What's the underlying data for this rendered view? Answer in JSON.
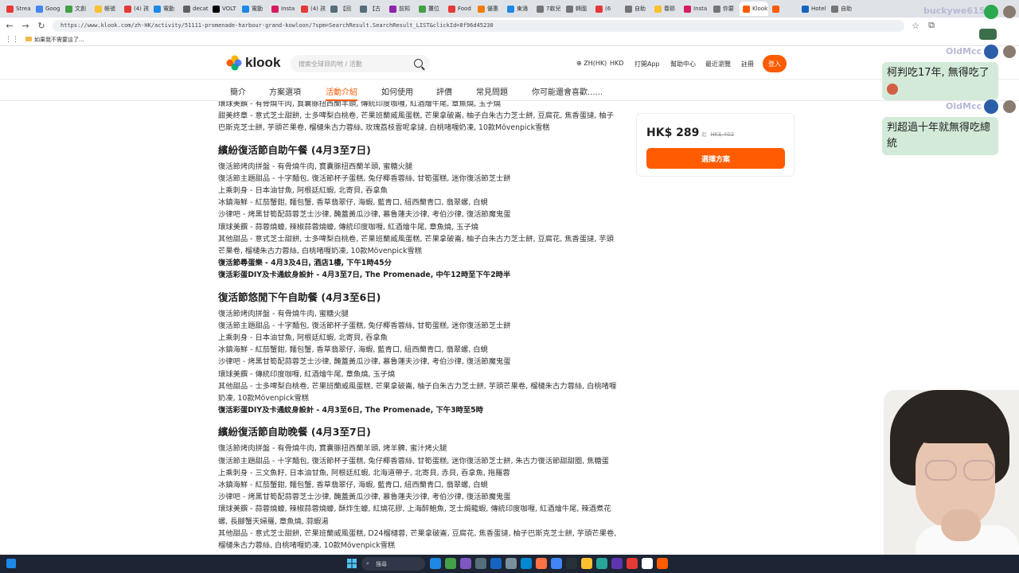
{
  "browser": {
    "tabs": [
      "Strea",
      "Goog",
      "文創",
      "帳號",
      "(4) 孩",
      "電動",
      "decat",
      "VOLT",
      "電動",
      "Insta",
      "(4) 孩",
      "【回",
      "【古",
      "前知",
      "攤位",
      "Food",
      "優惠",
      "東涌",
      "7款兒",
      "韓國",
      "(6",
      "自助",
      "春節",
      "Insta",
      "你要",
      "Klook",
      "",
      "Hotel",
      "自助"
    ],
    "tab_colors": [
      "#e53935",
      "#4285f4",
      "#43a047",
      "#fbc02d",
      "#e53935",
      "#1e88e5",
      "#616161",
      "#000000",
      "#1e88e5",
      "#d81b60",
      "#e53935",
      "#546e7a",
      "#546e7a",
      "#8e24aa",
      "#43a047",
      "#e53935",
      "#f57c00",
      "#1e88e5",
      "#757575",
      "#757575",
      "#e53935",
      "#757575",
      "#fbc02d",
      "#d81b60",
      "#757575",
      "#ff5b00",
      "#ff5b00",
      "#1565c0",
      "#757575"
    ],
    "url": "https://www.klook.com/zh-HK/activity/51111-promenade-harbour-grand-kowloon/?spm=SearchResult.SearchResult_LIST&clickId=8f96d45230",
    "bookmark": "如果我不需要這了..."
  },
  "header": {
    "logo_text": "klook",
    "search_placeholder": "搜索全球目的地 / 活動",
    "lang": "ZH(HK)",
    "currency": "HKD",
    "app": "打開App",
    "help": "幫助中心",
    "recent": "最近瀏覽",
    "register": "註冊",
    "login": "登入"
  },
  "subnav": [
    "簡介",
    "方案選項",
    "活動介紹",
    "如何使用",
    "評價",
    "常見問題",
    "你可能還會喜歡......"
  ],
  "price_card": {
    "price": "HK$ 289",
    "unit": "起",
    "old_price": "HK$ 402",
    "button": "選擇方案"
  },
  "content": [
    {
      "type": "line",
      "text": "環球美饌 - 有骨燒牛肉, 寶囊豚扭西蘭羊頭, 傳統印度咖喱, 紅酒燴牛尾, 章魚燒, 玉子燒"
    },
    {
      "type": "wrap",
      "text": "甜美終章 - 意式芝士甜餅, 士多啤梨白桃卷, 芒果班蘭威風蛋糕, 芒果拿破崙, 柚子白朱古力芝士餅, 豆腐花, 焦香蛋撻, 柚子巴斯克芝士餅, 芋頭芒果卷, 榴槤朱古力蓉絲, 玫瑰荔枝雲呢拿撻, 白桃啫喱奶凍, 10款Mövenpick雪糕"
    },
    {
      "type": "heading",
      "text": "繽紛復活節自助午餐 (4月3至7日)"
    },
    {
      "type": "line",
      "text": "復活節烤肉拼盤 - 有骨燒牛肉, 寶囊豚扭西蘭羊頭, 蜜糖火腿"
    },
    {
      "type": "line",
      "text": "復活節主題甜品 - 十字麵包, 復活節杯子蛋糕, 兔仔椰香蓉絲, 甘筍蛋糕, 迷你復活節芝士餅"
    },
    {
      "type": "line",
      "text": "上乘刺身 - 日本油甘魚, 阿根廷紅蝦, 北寄貝, 吞拿魚"
    },
    {
      "type": "line",
      "text": "冰鎮海鮮 - 紅茄蟹鉗, 麵包蟹, 香草翡翠仔, 海蝦, 藍青口, 紐西蘭青口, 翡翠螺, 白蜆"
    },
    {
      "type": "line",
      "text": "沙律吧 - 烤黑甘筍配蒜蓉芝士沙律, 醃蓋黃瓜沙律, 慕魯蓮夫沙律, 考伯沙律, 復活節魔鬼蛋"
    },
    {
      "type": "line",
      "text": "環球美饌 - 蒜蓉燒蠔, 辣椒蒜蓉燒蠔, 傳統印度咖喱, 紅酒燴牛尾, 章魚燒, 玉子燒"
    },
    {
      "type": "wrap",
      "text": "其他甜品 - 意式芝士甜餅, 士多啤梨白桃卷, 芒果班蘭威風蛋糕, 芒果拿破崙, 柚子白朱古力芝士餅, 豆腐花, 焦香蛋撻, 芋頭芒果卷, 榴槤朱古力蓉絲, 白桃啫喱奶凍, 10款Mövenpick雪糕"
    },
    {
      "type": "bold",
      "text": "復活節尋蛋樂 - 4月3及4日, 酒店1樓, 下午1時45分"
    },
    {
      "type": "bold",
      "text": "復活彩蛋DIY及卡通紋身設計 - 4月3至7日, The Promenade, 中午12時至下午2時半"
    },
    {
      "type": "heading",
      "text": "復活節悠閒下午自助餐 (4月3至6日)"
    },
    {
      "type": "line",
      "text": "復活節烤肉拼盤 - 有骨燒牛肉, 蜜糖火腿"
    },
    {
      "type": "line",
      "text": "復活節主題甜品 - 十字麵包, 復活節杯子蛋糕, 兔仔椰香蓉絲, 甘筍蛋糕, 迷你復活節芝士餅"
    },
    {
      "type": "line",
      "text": "上乘刺身 - 日本油甘魚, 阿根廷紅蝦, 北寄貝, 吞拿魚"
    },
    {
      "type": "line",
      "text": "冰鎮海鮮 - 紅茄蟹鉗, 麵包蟹, 香草翡翠仔, 海蝦, 藍青口, 紐西蘭青口, 翡翠螺, 白蜆"
    },
    {
      "type": "line",
      "text": "沙律吧 - 烤黑甘筍配蒜蓉芝士沙律, 醃蓋黃瓜沙律, 慕魯蓮夫沙律, 考伯沙律, 復活節魔鬼蛋"
    },
    {
      "type": "line",
      "text": "環球美饌 - 傳統印度咖喱, 紅酒燴牛尾, 章魚燒, 玉子燒"
    },
    {
      "type": "wrap",
      "text": "其他甜品 - 士多啤梨白桃卷, 芒果班蘭威風蛋糕, 芒果拿破崙, 柚子白朱古力芝士餅, 芋頭芒果卷, 榴槤朱古力蓉絲, 白桃啫喱奶凍, 10款Mövenpick雪糕"
    },
    {
      "type": "bold",
      "text": "復活彩蛋DIY及卡通紋身設計 - 4月3至6日, The Promenade, 下午3時至5時"
    },
    {
      "type": "heading",
      "text": "繽紛復活節自助晚餐 (4月3至7日)"
    },
    {
      "type": "line",
      "text": "復活節烤肉拼盤 - 有骨燒牛肉, 寶囊豚扭西蘭羊頭, 烤羊髀, 蜜汁烤火腿"
    },
    {
      "type": "wrap",
      "text": "復活節主題甜品 - 十字麵包, 復活節杯子蛋糕, 兔仔椰香蓉絲, 甘筍蛋糕, 迷你復活節芝士餅, 朱古力復活節甜甜圈, 焦糖蛋"
    },
    {
      "type": "line",
      "text": "上乘刺身 - 三文魚籽, 日本油甘魚, 阿根廷紅蝦, 北海道帶子, 北寄貝, 赤貝, 吞拿魚, 拖羅蓉"
    },
    {
      "type": "line",
      "text": "冰鎮海鮮 - 紅茄蟹鉗, 麵包蟹, 香草翡翠仔, 海蝦, 藍青口, 紐西蘭青口, 翡翠螺, 白蜆"
    },
    {
      "type": "line",
      "text": "沙律吧 - 烤黑甘筍配蒜蓉芝士沙律, 醃蓋黃瓜沙律, 慕魯蓮夫沙律, 考伯沙律, 復活節魔鬼蛋"
    },
    {
      "type": "wrap",
      "text": "環球美饌 - 蒜蓉燒蠔, 辣椒蒜蓉燒蠔, 酥炸生蠔, 紅燒花膠, 上海醉鮑魚, 芝士焗龍蝦, 傳統印度咖喱, 紅酒燴牛尾, 辣酒煮花螺, 長腳蟹天婦羅, 章魚燒, 蒜蝦湯"
    },
    {
      "type": "wrap",
      "text": "其他甜品 - 意式芝士甜餅, 芒果班蘭威風蛋糕, D24榴槤蓉, 芒果拿破崙, 豆腐花, 焦香蛋撻, 柚子巴斯克芝士餅, 芋頭芒果卷, 榴槤朱古力蓉絲, 白桃啫喱奶凍, 10款Mövenpick雪糕"
    }
  ],
  "chat": {
    "user1": "buckywe615",
    "user2": "OldMcc",
    "msg1": "柯判吃17年, 無得吃了",
    "user3": "OldMcc",
    "msg2": "判超過十年就無得吃總統"
  },
  "taskbar": {
    "search": "搜尋",
    "icon_colors": [
      "#1e88e5",
      "#43a047",
      "#7e57c2",
      "#546e7a",
      "#1565c0",
      "#78909c",
      "#0288d1",
      "#ff7043",
      "#4285f4",
      "#263238",
      "#fbc02d",
      "#26a69a",
      "#5e35b1",
      "#e53935",
      "#ffffff",
      "#ff5b00"
    ]
  }
}
